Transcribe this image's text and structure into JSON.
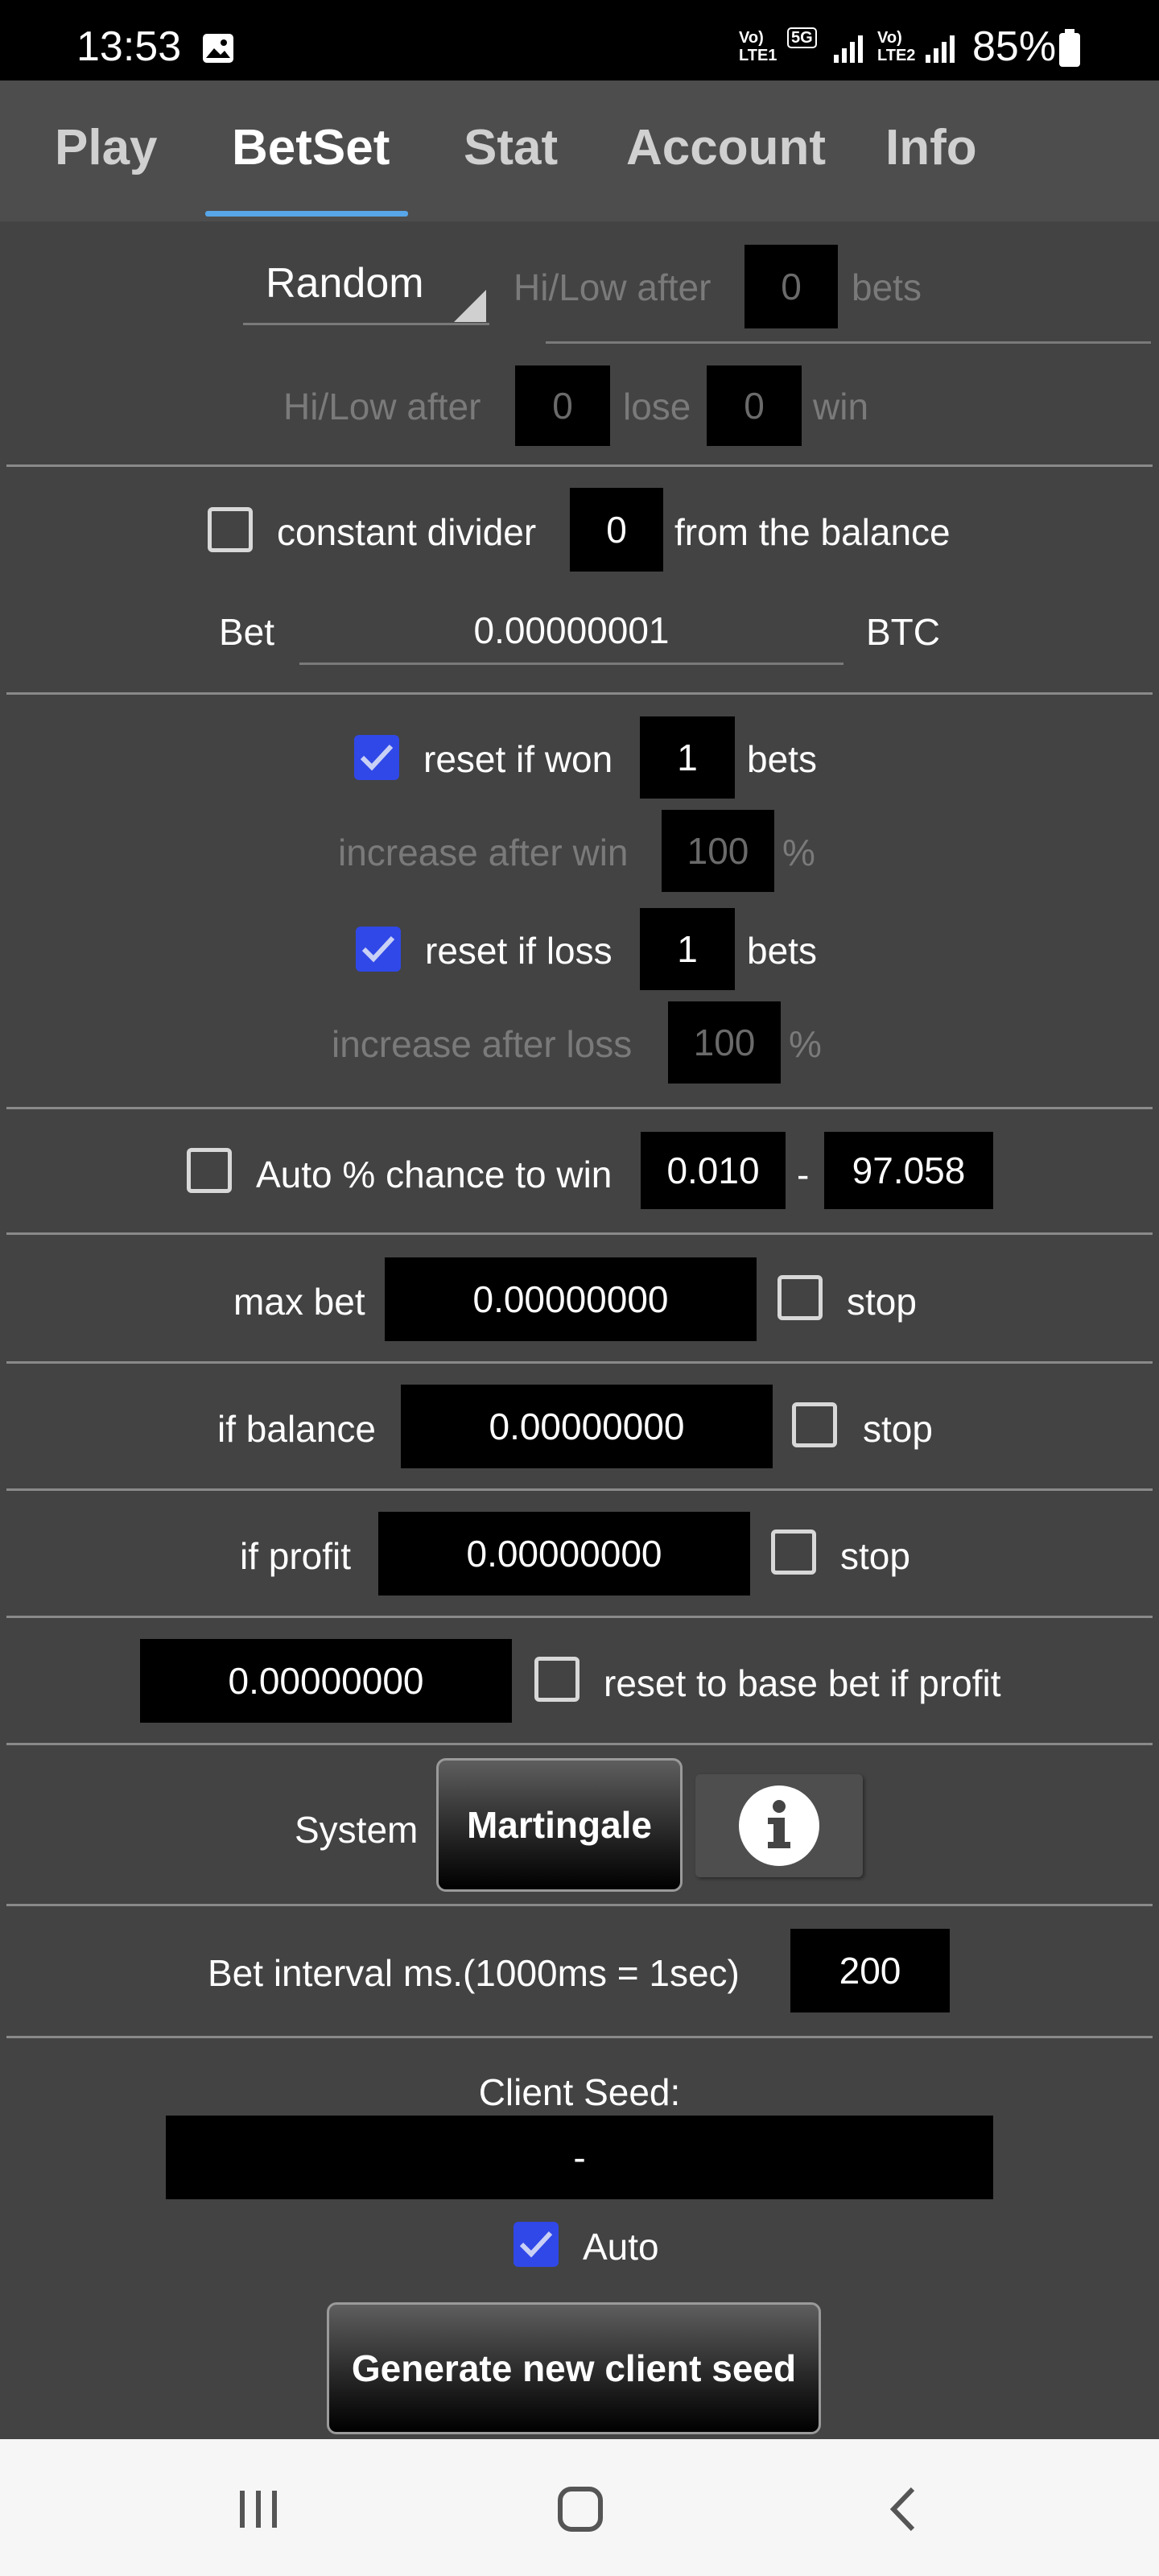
{
  "status_bar": {
    "time": "13:53",
    "battery": "85%",
    "sim1": "Vo) LTE1",
    "sim2": "Vo) LTE2",
    "network": "5G"
  },
  "tabs": [
    {
      "label": "Play"
    },
    {
      "label": "BetSet"
    },
    {
      "label": "Stat"
    },
    {
      "label": "Account"
    },
    {
      "label": "Info"
    }
  ],
  "mode": {
    "selected": "Random",
    "hilow_after_label": "Hi/Low after",
    "hilow_after_value": "0",
    "bets_label": "bets"
  },
  "hilow2": {
    "label": "Hi/Low after",
    "lose_value": "0",
    "lose_label": "lose",
    "win_value": "0",
    "win_label": "win"
  },
  "divider_row": {
    "label": "constant divider",
    "value": "0",
    "suffix": "from the balance",
    "checked": false
  },
  "bet": {
    "label": "Bet",
    "value": "0.00000001",
    "currency": "BTC"
  },
  "reset_won": {
    "label": "reset if won",
    "value": "1",
    "suffix": "bets",
    "checked": true
  },
  "inc_win": {
    "label": "increase after win",
    "value": "100",
    "suffix": "%"
  },
  "reset_loss": {
    "label": "reset if loss",
    "value": "1",
    "suffix": "bets",
    "checked": true
  },
  "inc_loss": {
    "label": "increase after loss",
    "value": "100",
    "suffix": "%"
  },
  "auto_chance": {
    "label": "Auto % chance to win",
    "min": "0.010",
    "sep": "-",
    "max": "97.058",
    "checked": false
  },
  "max_bet": {
    "label": "max bet",
    "value": "0.00000000",
    "stop_label": "stop"
  },
  "if_balance": {
    "label": "if balance",
    "value": "0.00000000",
    "stop_label": "stop"
  },
  "if_profit": {
    "label": "if profit",
    "value": "0.00000000",
    "stop_label": "stop"
  },
  "reset_profit": {
    "value": "0.00000000",
    "label": "reset to base bet if profit"
  },
  "system": {
    "label": "System",
    "button": "Martingale",
    "info_icon": "info-icon"
  },
  "interval": {
    "label": "Bet interval ms.(1000ms = 1sec)",
    "value": "200"
  },
  "client_seed": {
    "label": "Client Seed:",
    "value": "-",
    "auto_label": "Auto",
    "auto_checked": true,
    "generate_button": "Generate new client seed"
  },
  "nav": {
    "recent_icon": "recent-apps-icon",
    "home_icon": "home-icon",
    "back_icon": "back-icon"
  },
  "colors": {
    "background": "#434343",
    "accent": "#58a6e8",
    "checkbox": "#3048e8"
  }
}
